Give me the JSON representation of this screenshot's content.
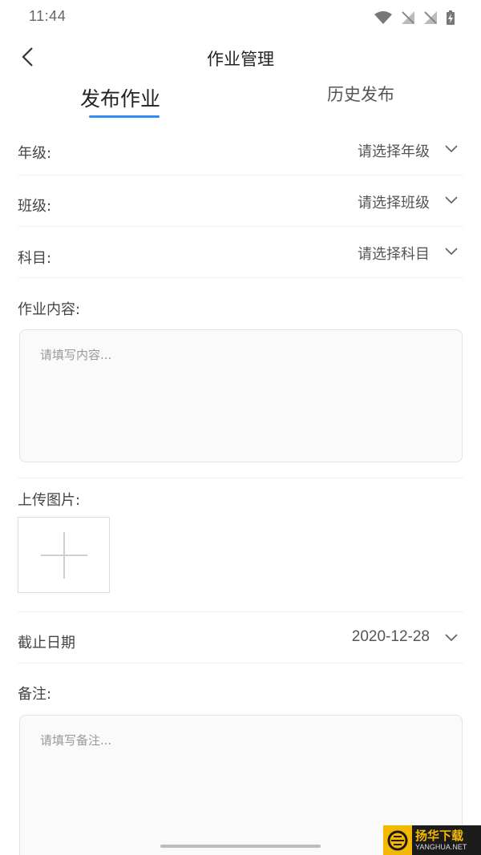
{
  "status_bar": {
    "time": "11:44",
    "icons": [
      "wifi-icon",
      "signal-off-icon",
      "signal-off-icon",
      "battery-charging-icon"
    ]
  },
  "nav": {
    "title": "作业管理",
    "back_icon": "chevron-left-icon"
  },
  "tabs": [
    {
      "label": "发布作业",
      "active": true
    },
    {
      "label": "历史发布",
      "active": false
    }
  ],
  "form": {
    "grade": {
      "label": "年级:",
      "placeholder": "请选择年级"
    },
    "class": {
      "label": "班级:",
      "placeholder": "请选择班级"
    },
    "subject": {
      "label": "科目:",
      "placeholder": "请选择科目"
    },
    "content": {
      "label": "作业内容:",
      "placeholder": "请填写内容..."
    },
    "upload": {
      "label": "上传图片:"
    },
    "deadline": {
      "label": "截止日期",
      "value": "2020-12-28"
    },
    "remark": {
      "label": "备注:",
      "placeholder": "请填写备注..."
    }
  },
  "watermark": {
    "cn": "扬华下载",
    "en": "YANGHUA.NET"
  },
  "colors": {
    "accent": "#2f8ff0"
  }
}
